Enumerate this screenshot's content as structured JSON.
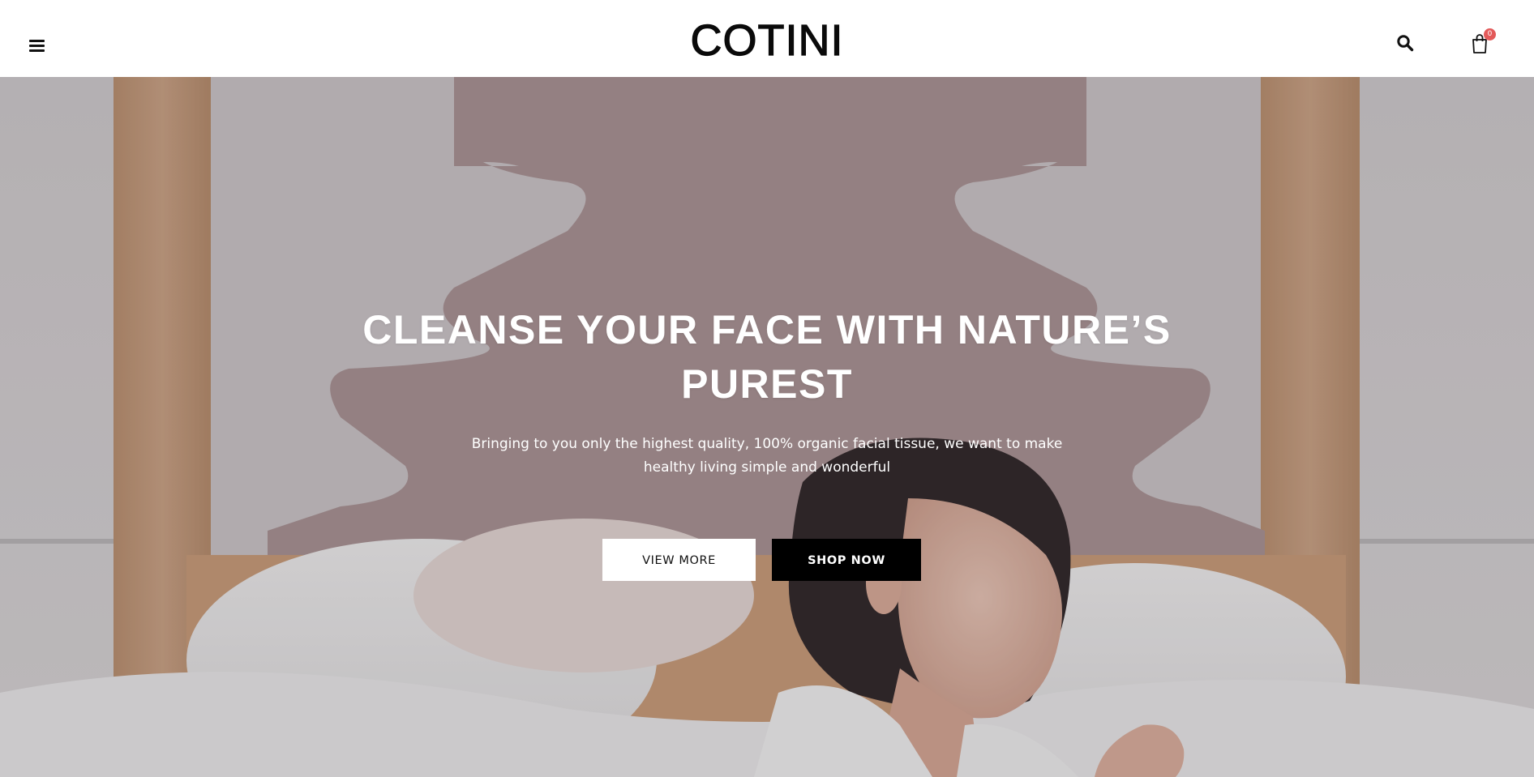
{
  "header": {
    "brand": "COTINI",
    "menu_icon": "hamburger-menu-icon",
    "search_icon": "search-icon",
    "cart_icon": "shopping-bag-icon",
    "cart_count": "0"
  },
  "hero": {
    "title": "CLEANSE YOUR FACE WITH NATURE’S PUREST",
    "subtitle": "Bringing to you only the highest quality, 100% organic facial tissue, we want to make healthy living simple and wonderful",
    "view_more_label": "VIEW MORE",
    "shop_now_label": "SHOP NOW"
  },
  "colors": {
    "badge": "#e35a5a",
    "primary_button": "#000000",
    "secondary_button": "#ffffff"
  }
}
